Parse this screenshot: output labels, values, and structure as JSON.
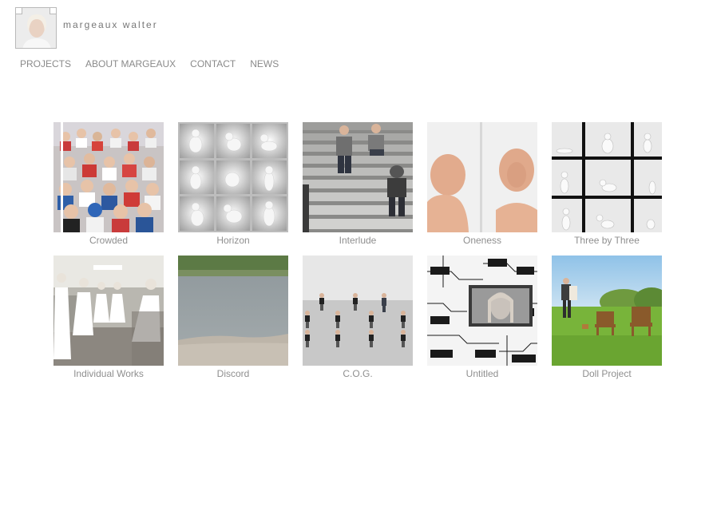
{
  "site": {
    "name": "margeaux walter",
    "logo_icon": "portrait-avatar-icon"
  },
  "nav": [
    {
      "label": "PROJECTS"
    },
    {
      "label": "ABOUT MARGEAUX"
    },
    {
      "label": "CONTACT"
    },
    {
      "label": "NEWS"
    }
  ],
  "projects": [
    {
      "title": "Crowded"
    },
    {
      "title": "Horizon"
    },
    {
      "title": "Interlude"
    },
    {
      "title": "Oneness"
    },
    {
      "title": "Three by Three"
    },
    {
      "title": "Individual Works"
    },
    {
      "title": "Discord"
    },
    {
      "title": "C.O.G."
    },
    {
      "title": "Untitled"
    },
    {
      "title": "Doll Project"
    }
  ],
  "colors": {
    "nav_text": "#8a8a8a",
    "caption_text": "#8f8f8f",
    "background": "#ffffff"
  }
}
